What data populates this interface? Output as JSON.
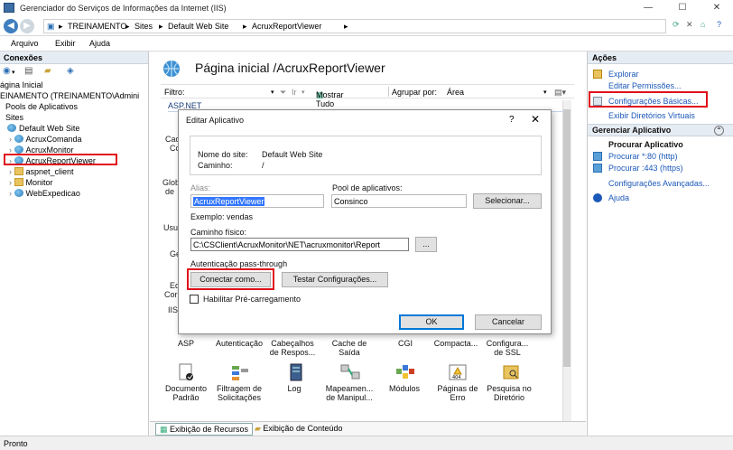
{
  "window": {
    "title": "Gerenciador do Serviços de Informações da Internet (IIS)",
    "min": "—",
    "max": "☐",
    "close": "✕"
  },
  "address": {
    "crumbs": [
      "TREINAMENTO",
      "Sites",
      "Default Web Site",
      "AcruxReportViewer"
    ],
    "sep": "▸"
  },
  "menu": [
    "Arquivo",
    "Exibir",
    "Ajuda"
  ],
  "connections": {
    "header": "Conexões",
    "tree": [
      "ágina Inicial",
      "EINAMENTO (TREINAMENTO\\Admini",
      "Pools de Aplicativos",
      "Sites",
      "Default Web Site",
      "AcruxComanda",
      "AcruxMonitor",
      "AcruxReportViewer",
      "aspnet_client",
      "Monitor",
      "WebExpedicao"
    ]
  },
  "main": {
    "title": "Página inicial /AcruxReportViewer",
    "filter_label": "Filtro:",
    "ir_label": "Ir",
    "show_all": "Mostrar Tudo",
    "group_label": "Agrupar por:",
    "group_value": "Área",
    "section": "ASP.NET",
    "partial_labels": [
      "Cad",
      "Co",
      "Glob",
      "de",
      "Usu",
      "Ge",
      "Ed",
      "Cor",
      "IIS"
    ],
    "features_row1": [
      "ASP",
      "Autenticação",
      "Cabeçalhos de Respos...",
      "Cache de Saída",
      "CGI",
      "Compacta...",
      "Configura... de SSL"
    ],
    "features_row2": [
      "Documento Padrão",
      "Filtragem de Solicitações",
      "Log",
      "Mapeamen... de Manipul...",
      "Módulos",
      "Páginas de Erro",
      "Pesquisa no Diretório"
    ],
    "tab_features": "Exibição de Recursos",
    "tab_content": "Exibição de Conteúdo"
  },
  "actions": {
    "header": "Ações",
    "explore": "Explorar",
    "edit_perms": "Editar Permissões...",
    "basic_settings": "Configurações Básicas...",
    "virtual_dirs": "Exibir Diretórios Virtuais",
    "manage_header": "Gerenciar Aplicativo",
    "browse_header": "Procurar Aplicativo",
    "browse_80": "Procurar *:80 (http)",
    "browse_443": "Procurar :443 (https)",
    "advanced": "Configurações Avançadas...",
    "help": "Ajuda"
  },
  "dialog": {
    "title": "Editar Aplicativo",
    "help": "?",
    "close": "✕",
    "site_name_label": "Nome do site:",
    "site_name": "Default Web Site",
    "path_label": "Caminho:",
    "path": "/",
    "alias_label": "Alias:",
    "alias": "AcruxReportViewer",
    "pool_label": "Pool de aplicativos:",
    "pool": "Consinco",
    "select_btn": "Selecionar...",
    "example": "Exemplo: vendas",
    "physical_label": "Caminho físico:",
    "physical": "C:\\CSClient\\AcruxMonitor\\NET\\acruxmonitor\\Report",
    "browse_btn": "...",
    "passthrough": "Autenticação pass-through",
    "connect_btn": "Conectar como...",
    "test_btn": "Testar Configurações...",
    "preload": "Habilitar Pré-carregamento",
    "ok": "OK",
    "cancel": "Cancelar"
  },
  "status": "Pronto",
  "colors": {
    "highlight": "#e0101a",
    "link": "#1b58b8",
    "accent": "#0078d7"
  }
}
